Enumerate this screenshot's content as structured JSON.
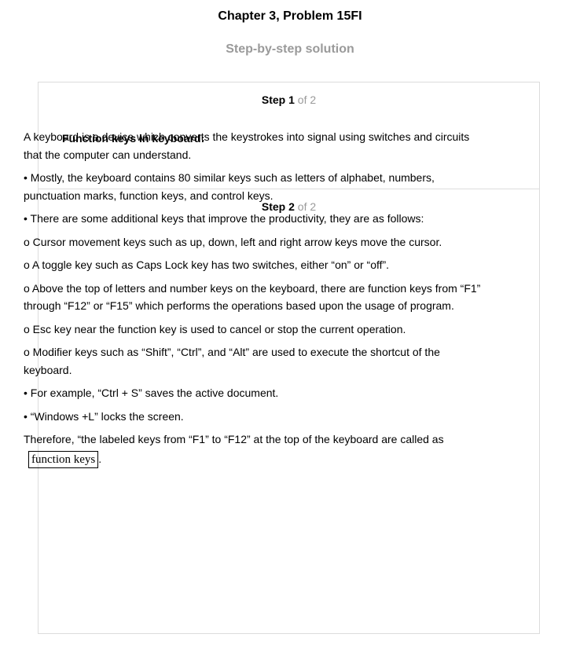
{
  "header": {
    "title": "Chapter 3, Problem 15FI",
    "subtitle": "Step-by-step solution"
  },
  "steps": [
    {
      "step_word": "Step",
      "number": "1",
      "of_total": "of 2",
      "heading": "Function keys in keyboard:"
    },
    {
      "step_word": "Step",
      "number": "2",
      "of_total": "of 2",
      "paragraphs": [
        "A keyboard is a device which converts the keystrokes into signal using switches and circuits that the computer can understand.",
        "• Mostly, the keyboard contains 80 similar keys such as letters of alphabet, numbers, punctuation marks, function keys, and control keys.",
        "• There are some additional keys that improve the productivity, they are as follows:",
        "o Cursor movement keys such as up, down, left and right arrow keys move the cursor.",
        "o A toggle key such as Caps Lock key has two switches, either “on” or “off”.",
        "o Above the top of letters and number keys on the keyboard, there are function keys from “F1” through “F12” or “F15” which performs the operations based upon the usage of program.",
        "o Esc key near the function key is used to cancel or stop the current operation.",
        "o Modifier keys such as “Shift”, “Ctrl”, and “Alt” are used to execute the shortcut of the keyboard.",
        "• For example, “Ctrl + S” saves the active document.",
        "• “Windows +L” locks the screen.",
        "Therefore, “the labeled keys from “F1” to “F12” at the top of the keyboard are called as"
      ],
      "answer": "function keys",
      "answer_suffix": "."
    }
  ]
}
